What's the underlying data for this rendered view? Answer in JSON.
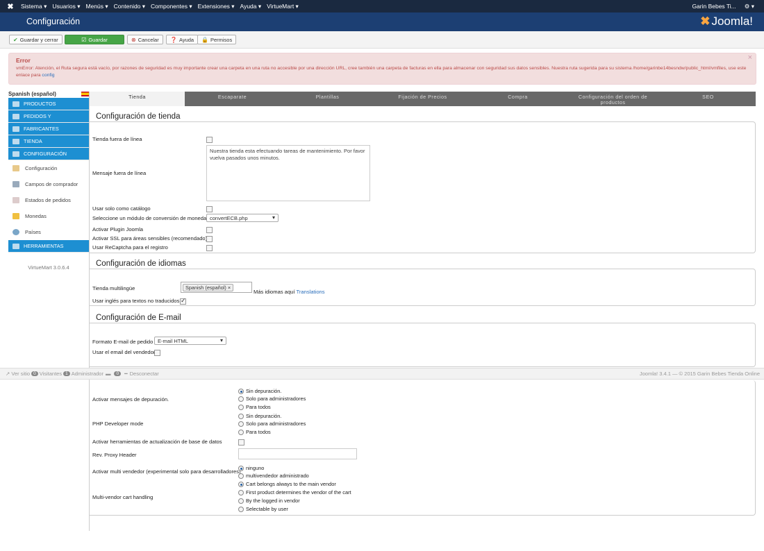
{
  "topnav": {
    "menu": [
      "Sistema ▾",
      "Usuarios ▾",
      "Menús ▾",
      "Contenido ▾",
      "Componentes ▾",
      "Extensiones ▾",
      "Ayuda ▾",
      "VirtueMart ▾"
    ],
    "user": "Garin Bebes Ti...",
    "settings": "⚙ ▾"
  },
  "header": {
    "title": "Configuración",
    "brand": "Joomla!"
  },
  "toolbar": {
    "save_close": "Guardar y cerrar",
    "save": "Guardar",
    "cancel": "Cancelar",
    "help": "Ayuda",
    "permissions": "Permisos"
  },
  "alert": {
    "title": "Error",
    "message": "vmError: Atención, el Ruta segura está vacío, por razones de seguridad es muy importante crear una carpeta en una ruta no accesible por una dirección URL, cree también una carpeta de facturas en ella para almacenar con seguridad sus datos sensibles. Nuestra ruta sugerida para su sistema /home/garinbe14besndw/public_html/vmfiles, use este enlace para",
    "link": "config",
    "close": "×"
  },
  "sidebar": {
    "language": "Spanish (español)",
    "sections": [
      "PRODUCTOS",
      "PEDIDOS Y",
      "FABRICANTES",
      "TIENDA",
      "CONFIGURACIÓN"
    ],
    "subitems": [
      "Configuración",
      "Campos de comprador",
      "Estados de pedidos",
      "Monedas",
      "Países"
    ],
    "tools": "HERRAMIENTAS",
    "version": "VirtueMart 3.0.6.4"
  },
  "tabs": [
    "Tienda",
    "Escaparate",
    "Plantillas",
    "Fijación de Precios",
    "Compra",
    "Configuración del orden de productos",
    "SEO"
  ],
  "store": {
    "legend": "Configuración de tienda",
    "offline": "Tienda fuera de línea",
    "offline_msg_label": "Mensaje fuera de línea",
    "offline_msg": "Nuestra tienda esta efectuando tareas de mantenimiento. Por favor vuelva pasados unos minutos.",
    "catalog": "Usar solo como catálogo",
    "currency_module_label": "Seleccione un módulo de conversión de moneda",
    "currency_module": "convertECB.php",
    "joomla_plugin": "Activar Plugin Joomla",
    "ssl": "Activar SSL para áreas sensibles (recomendado)",
    "recaptcha": "Usar ReCaptcha para el registro"
  },
  "languages": {
    "legend": "Configuración de idiomas",
    "multilang": "Tienda multilingüe",
    "tag": "Spanish (español) ×",
    "more": "Más idiomas aquí",
    "more_link": "Translations",
    "english": "Usar inglés para textos no traducidos"
  },
  "email": {
    "legend": "Configuración de E-mail",
    "format_label": "Formato E-mail de pedido",
    "format": "E-mail HTML",
    "vendor_email": "Usar el email del vendedor"
  },
  "footer": {
    "site": "Ver sitio",
    "visitors_count": "0",
    "visitors": "Visitantes",
    "admin_count": "1",
    "admin": "Administrador",
    "msg_count": "0",
    "logout": "Desconectar",
    "copyright": "Joomla! 3.4.1 — © 2015 Garin Bebes Tienda Online"
  },
  "debug": {
    "debug_label": "Activar mensajes de depuración.",
    "debug_options": [
      "Sin depuración.",
      "Solo para administradores",
      "Para todos"
    ],
    "php_label": "PHP Developer mode",
    "php_options": [
      "Sin depuración.",
      "Solo para administradores",
      "Para todos"
    ],
    "db_tools": "Activar herramientas de actualización de base de datos",
    "proxy": "Rev. Proxy Header",
    "multivendor_label": "Activar multi vendedor (experimental solo para desarrolladores)",
    "multivendor_options": [
      "ninguno",
      "multivendedor administrado"
    ],
    "cart_label": "Multi-vendor cart handling",
    "cart_options": [
      "Cart belongs always to the main vendor",
      "First product determines the vendor of the cart",
      "By the logged in vendor",
      "Selectable by user"
    ]
  }
}
